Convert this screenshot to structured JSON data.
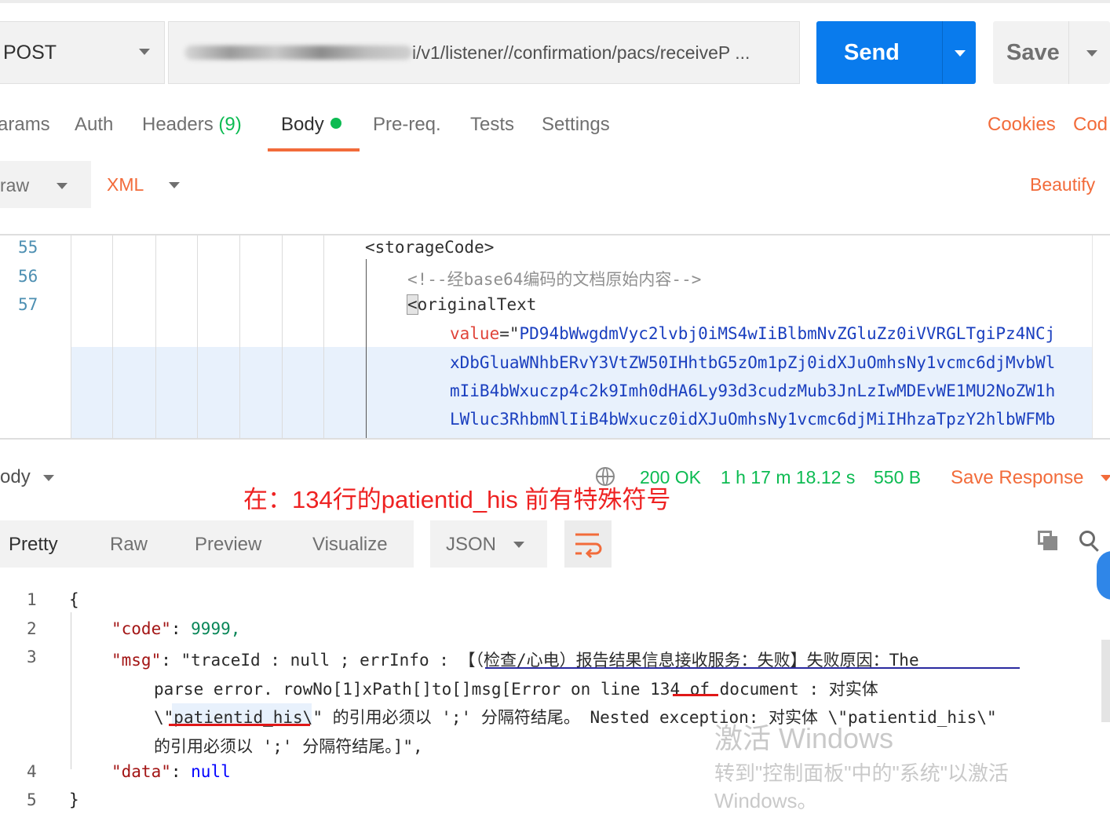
{
  "request": {
    "method": "POST",
    "url_visible": "i/v1/listener//confirmation/pacs/receiveP ...",
    "send_label": "Send",
    "save_label": "Save"
  },
  "request_tabs": {
    "params": "arams",
    "auth": "Auth",
    "headers": "Headers",
    "headers_count": "(9)",
    "body": "Body",
    "prereq": "Pre-req.",
    "tests": "Tests",
    "settings": "Settings",
    "cookies": "Cookies",
    "code": "Cod"
  },
  "body_mode": {
    "mode": "raw",
    "language": "XML",
    "beautify": "Beautify"
  },
  "editor": {
    "line_numbers": [
      "55",
      "56",
      "57"
    ],
    "lines": {
      "l55": "<storageCode>",
      "l56": "<!--经base64编码的文档原始内容-->",
      "l57_bracket": "<",
      "l57_tag": "originalText",
      "attr_name": "value",
      "attr_eq": "=\"",
      "wrap1": "PD94bWwgdmVyc2lvbj0iMS4wIiBlbmNvZGluZz0iVVRGLTgiPz4NCj",
      "wrap2": "xDbGluaWNhbERvY3VtZW50IHhtbG5zOm1pZj0idXJuOmhsNy1vcmc6djMvbWl",
      "wrap3": "mIiB4bWxuczp4c2k9Imh0dHA6Ly93d3cudzMub3JnLzIwMDEvWE1MU2NoZW1h",
      "wrap4": "LWluc3RhbmNlIiB4bWxucz0idXJuOmhsNy1vcmc6djMiIHhzaTpzY2hlbWFMb"
    }
  },
  "response_bar": {
    "label": "ody",
    "status": "200 OK",
    "time": "1 h 17 m 18.12 s",
    "size": "550 B",
    "save_response": "Save Response"
  },
  "annotation": "在：134行的patientid_his 前有特殊符号",
  "response_tabs": {
    "pretty": "Pretty",
    "raw": "Raw",
    "preview": "Preview",
    "visualize": "Visualize",
    "format": "JSON"
  },
  "response": {
    "line_numbers": [
      "1",
      "2",
      "3",
      "",
      "",
      "",
      "4",
      "5"
    ],
    "open_brace": "{",
    "code_key": "\"code\"",
    "code_value": "9999,",
    "msg_key": "\"msg\"",
    "msg_line1": "\"traceId : null ; errInfo : 【（检查/心电）报告结果信息接收服务：失败】失败原因：The",
    "msg_line2a": "parse error. rowNo[1]xPath[]to[]msg[Error on line ",
    "msg_line2b": "134",
    "msg_line2c": " of document  : 对实体",
    "msg_line3a": "\\\"",
    "msg_line3b": "patientid_his",
    "msg_line3c": "\\\" 的引用必须以 ';' 分隔符结尾。 Nested exception: 对实体 \\\"patientid_his\\\"",
    "msg_line4": "的引用必须以 ';' 分隔符结尾。]\",",
    "data_key": "\"data\"",
    "data_value": "null",
    "close_brace": "}"
  },
  "watermark": {
    "line1": "激活 Windows",
    "line2": "转到\"控制面板\"中的\"系统\"以激活",
    "line3": "Windows。"
  },
  "colors": {
    "accent": "#f26b3a",
    "send_blue": "#097bed",
    "status_green": "#0cbb52",
    "annotation_red": "#ee2222"
  },
  "icons": [
    "chevron-down-icon",
    "globe-icon",
    "copy-icon",
    "search-icon",
    "wrap-lines-icon"
  ]
}
